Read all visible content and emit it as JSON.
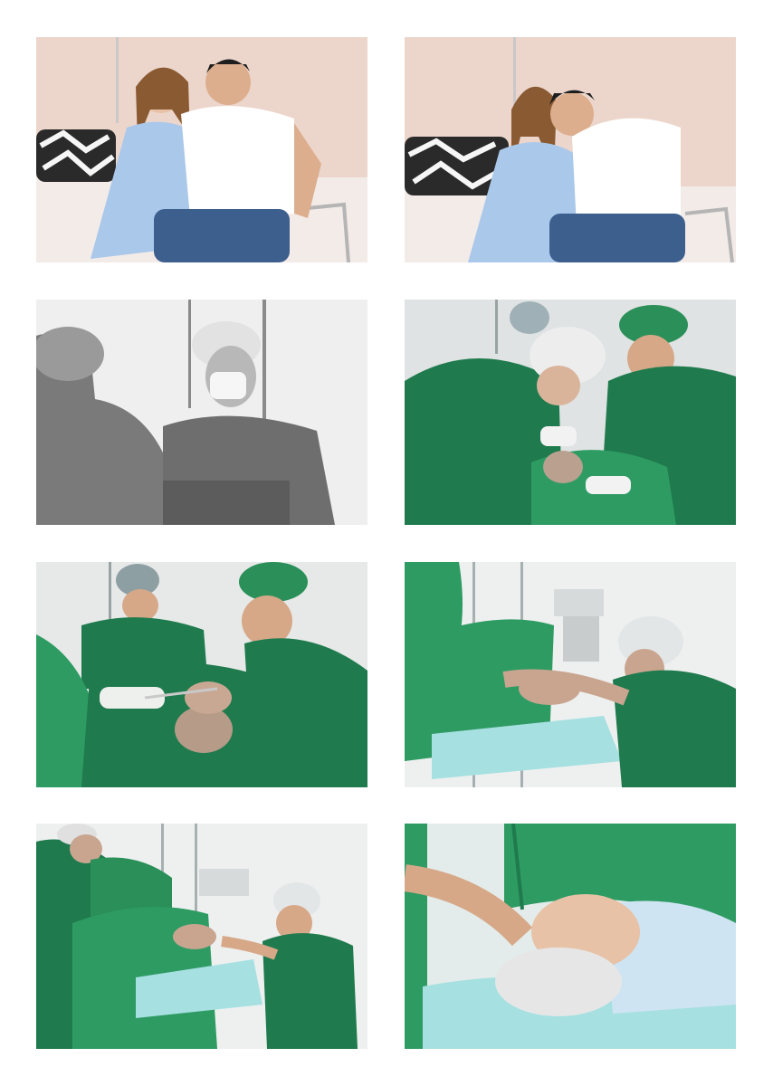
{
  "page": {
    "background": "#ffffff"
  },
  "photos": [
    {
      "id": "photo-1",
      "subject": "couple-sitting-on-hospital-bed",
      "palette": [
        "#ecd6cc",
        "#aac8ea",
        "#ffffff",
        "#3d5f8e"
      ]
    },
    {
      "id": "photo-2",
      "subject": "couple-embracing-belly",
      "palette": [
        "#ecd6cc",
        "#aac8ea",
        "#ffffff",
        "#3d5f8e"
      ]
    },
    {
      "id": "photo-3",
      "subject": "father-in-scrubs-black-and-white",
      "palette": [
        "#efefef",
        "#6e6e6e",
        "#cfcfcf"
      ]
    },
    {
      "id": "photo-4",
      "subject": "surgeons-delivering-baby",
      "palette": [
        "#dfe3e3",
        "#1f7a4d",
        "#2e9b63"
      ]
    },
    {
      "id": "photo-5",
      "subject": "newborn-held-above-drape",
      "palette": [
        "#e6e9e8",
        "#1f7a4d",
        "#2e9b63"
      ]
    },
    {
      "id": "photo-6",
      "subject": "anesthesiologist-holding-mother-head",
      "palette": [
        "#eef0f0",
        "#2e9b63",
        "#a6e0e0"
      ]
    },
    {
      "id": "photo-7",
      "subject": "operating-room-team",
      "palette": [
        "#eef0f0",
        "#1f7a4d",
        "#2e9b63",
        "#a6e0e0"
      ]
    },
    {
      "id": "photo-8",
      "subject": "mother-on-table-closeup",
      "palette": [
        "#e3ecea",
        "#2e9b63",
        "#cfe4f3",
        "#a6e0e0"
      ]
    }
  ]
}
